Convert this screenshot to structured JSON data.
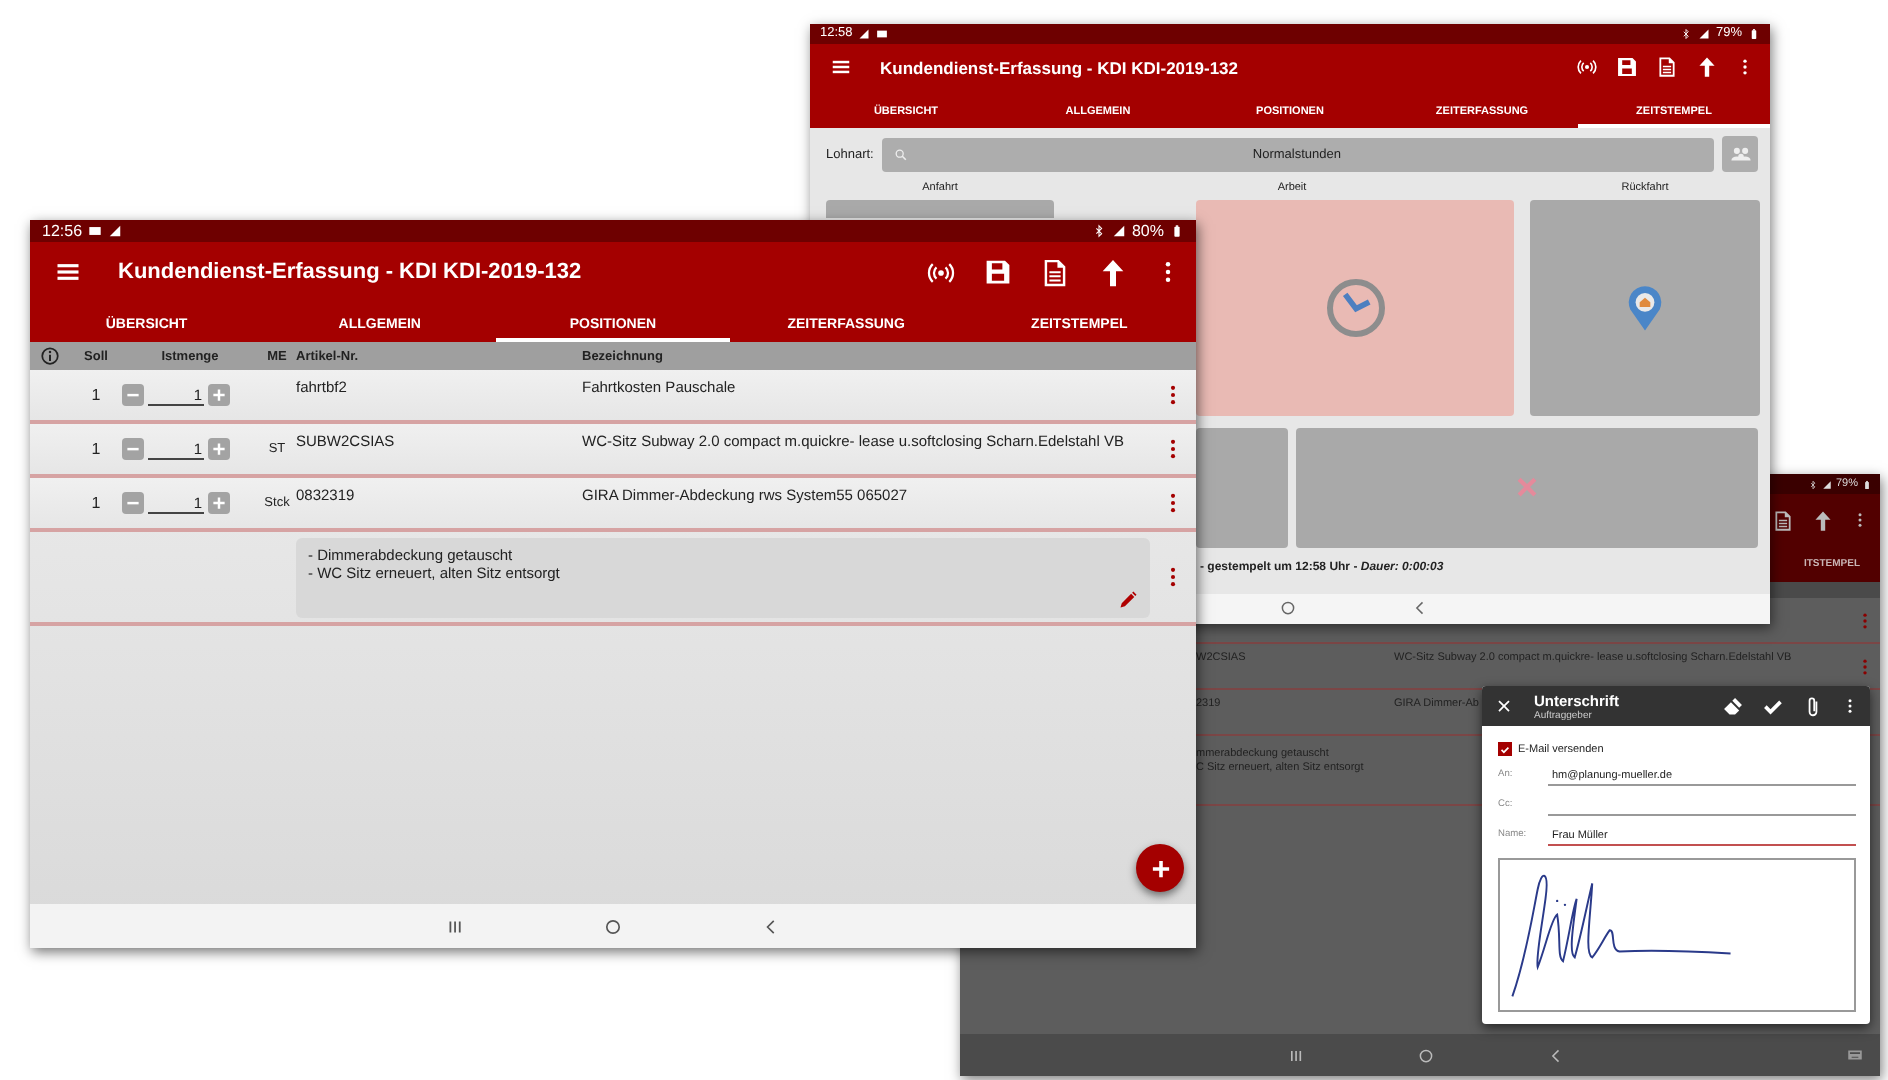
{
  "positions_screen": {
    "status_time": "12:56",
    "battery": "80%",
    "title": "Kundendienst-Erfassung - KDI KDI-2019-132",
    "tabs": [
      {
        "label": "ÜBERSICHT",
        "selected": false
      },
      {
        "label": "ALLGEMEIN",
        "selected": false
      },
      {
        "label": "POSITIONEN",
        "selected": true
      },
      {
        "label": "ZEITERFASSUNG",
        "selected": false
      },
      {
        "label": "ZEITSTEMPEL",
        "selected": false
      }
    ],
    "columns": [
      "Soll",
      "Istmenge",
      "ME",
      "Artikel-Nr.",
      "Bezeichnung"
    ],
    "rows": [
      {
        "target": "1",
        "quantity": "1",
        "article": "fahrtbf2",
        "description": "Fahrtkosten Pauschale"
      },
      {
        "target": "1",
        "quantity": "1",
        "unit": "ST",
        "article": "SUBW2CSIAS",
        "description": "WC-Sitz Subway 2.0 compact m.quickre- lease u.softclosing Scharn.Edelstahl VB"
      },
      {
        "target": "1",
        "quantity": "1",
        "unit": "Stck",
        "article": "0832319",
        "description": "GIRA Dimmer-Abdeckung rws System55 065027"
      }
    ],
    "note_lines": [
      "- Dimmerabdeckung getauscht",
      "- WC Sitz erneuert, alten Sitz entsorgt"
    ]
  },
  "timestamp_screen": {
    "status_time": "12:58",
    "battery": "79%",
    "title": "Kundendienst-Erfassung - KDI KDI-2019-132",
    "tabs": [
      {
        "label": "ÜBERSICHT",
        "selected": false
      },
      {
        "label": "ALLGEMEIN",
        "selected": false
      },
      {
        "label": "POSITIONEN",
        "selected": false
      },
      {
        "label": "ZEITERFASSUNG",
        "selected": false
      },
      {
        "label": "ZEITSTEMPEL",
        "selected": true
      }
    ],
    "wage_label": "Lohnart:",
    "wage_value": "Normalstunden",
    "tiles": [
      {
        "label": "Anfahrt",
        "selected": false
      },
      {
        "label": "Arbeit",
        "selected": true
      },
      {
        "label": "Rückfahrt",
        "selected": false
      }
    ],
    "footer": "- gestempelt um 12:58 Uhr - *Dauer: 0:00:03*"
  },
  "signature_screen": {
    "battery": "79%",
    "tab_fragment": "ITSTEMPEL",
    "rows": [
      {},
      {
        "article": "W2CSIAS",
        "description": "WC-Sitz Subway 2.0 compact m.quickre- lease u.softclosing Scharn.Edelstahl VB"
      },
      {
        "article": "2319",
        "description": "GIRA Dimmer-Ab"
      }
    ],
    "note_lines": [
      "mmerabdeckung getauscht",
      "C Sitz erneuert, alten Sitz entsorgt"
    ],
    "dialog": {
      "title": "Unterschrift",
      "subtitle": "Auftraggeber",
      "email": {
        "label": "E-Mail versenden",
        "checked": true
      },
      "fields": [
        {
          "label": "An:",
          "value": "hm@planung-mueller.de",
          "focused": false
        },
        {
          "label": "Cc:",
          "focused": false
        },
        {
          "label": "Name:",
          "value": "Frau Müller",
          "focused": true
        }
      ]
    }
  }
}
